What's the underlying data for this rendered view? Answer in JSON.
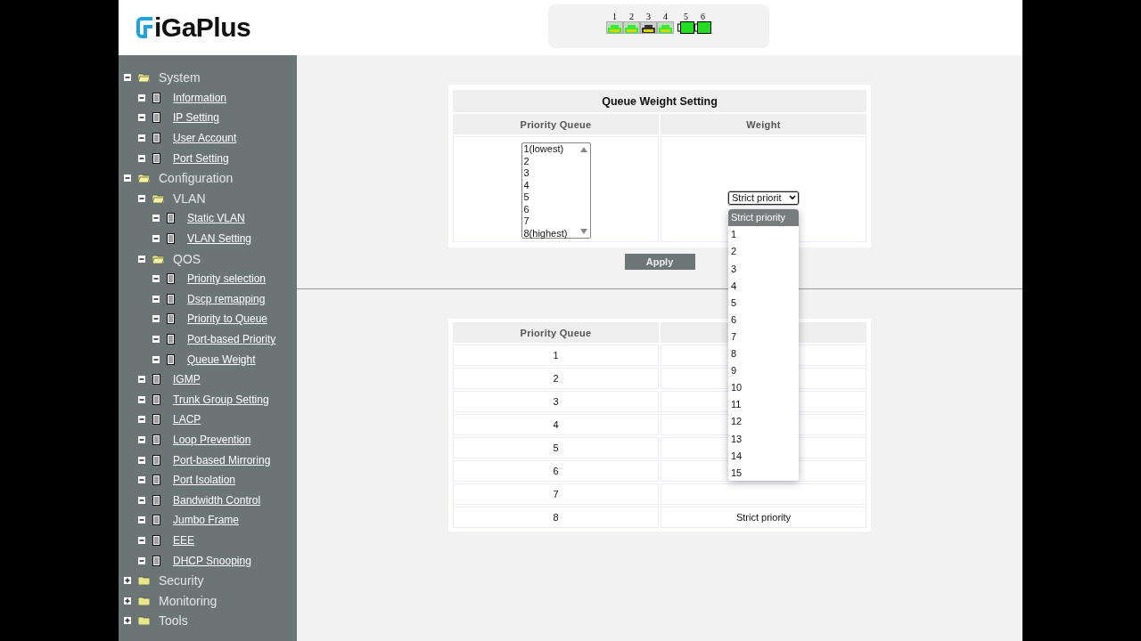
{
  "logo": {
    "prefix": "i",
    "text": "GaPlus"
  },
  "ports": [
    {
      "label": "1",
      "kind": "rj45",
      "link": true
    },
    {
      "label": "2",
      "kind": "rj45",
      "link": true
    },
    {
      "label": "3",
      "kind": "rj45",
      "link": false
    },
    {
      "label": "4",
      "kind": "rj45",
      "link": true
    },
    {
      "label": "5",
      "kind": "sfp",
      "link": true
    },
    {
      "label": "6",
      "kind": "sfp",
      "link": true
    }
  ],
  "sidebar": {
    "items": [
      {
        "label": "System",
        "kind": "folder",
        "expanded": true,
        "children": [
          {
            "label": "Information",
            "kind": "page"
          },
          {
            "label": "IP Setting",
            "kind": "page"
          },
          {
            "label": "User Account",
            "kind": "page"
          },
          {
            "label": "Port Setting",
            "kind": "page"
          }
        ]
      },
      {
        "label": "Configuration",
        "kind": "folder",
        "expanded": true,
        "children": [
          {
            "label": "VLAN",
            "kind": "folder",
            "expanded": true,
            "children": [
              {
                "label": "Static VLAN",
                "kind": "page"
              },
              {
                "label": "VLAN Setting",
                "kind": "page"
              }
            ]
          },
          {
            "label": "QOS",
            "kind": "folder",
            "expanded": true,
            "children": [
              {
                "label": "Priority selection",
                "kind": "page"
              },
              {
                "label": "Dscp remapping",
                "kind": "page"
              },
              {
                "label": "Priority to Queue",
                "kind": "page"
              },
              {
                "label": "Port-based Priority",
                "kind": "page"
              },
              {
                "label": "Queue Weight",
                "kind": "page"
              }
            ]
          },
          {
            "label": "IGMP",
            "kind": "page"
          },
          {
            "label": "Trunk Group Setting",
            "kind": "page"
          },
          {
            "label": "LACP",
            "kind": "page"
          },
          {
            "label": "Loop Prevention",
            "kind": "page"
          },
          {
            "label": "Port-based Mirroring",
            "kind": "page"
          },
          {
            "label": "Port Isolation",
            "kind": "page"
          },
          {
            "label": "Bandwidth Control",
            "kind": "page"
          },
          {
            "label": "Jumbo Frame",
            "kind": "page"
          },
          {
            "label": "EEE",
            "kind": "page"
          },
          {
            "label": "DHCP Snooping",
            "kind": "page"
          }
        ]
      },
      {
        "label": "Security",
        "kind": "folder",
        "expanded": false
      },
      {
        "label": "Monitoring",
        "kind": "folder",
        "expanded": false
      },
      {
        "label": "Tools",
        "kind": "folder",
        "expanded": false
      }
    ]
  },
  "setting": {
    "title": "Queue Weight Setting",
    "columns": [
      "Priority Queue",
      "Weight"
    ],
    "queues": [
      "1(lowest)",
      "2",
      "3",
      "4",
      "5",
      "6",
      "7",
      "8(highest)"
    ],
    "weight_select": {
      "value": "Strict priorit",
      "expanded": true,
      "options": [
        {
          "label": "Strict priority",
          "selected": true
        },
        {
          "label": "1",
          "selected": false
        },
        {
          "label": "2",
          "selected": false
        },
        {
          "label": "3",
          "selected": false
        },
        {
          "label": "4",
          "selected": false
        },
        {
          "label": "5",
          "selected": false
        },
        {
          "label": "6",
          "selected": false
        },
        {
          "label": "7",
          "selected": false
        },
        {
          "label": "8",
          "selected": false
        },
        {
          "label": "9",
          "selected": false
        },
        {
          "label": "10",
          "selected": false
        },
        {
          "label": "11",
          "selected": false
        },
        {
          "label": "12",
          "selected": false
        },
        {
          "label": "13",
          "selected": false
        },
        {
          "label": "14",
          "selected": false
        },
        {
          "label": "15",
          "selected": false
        }
      ]
    },
    "apply_button": "Apply"
  },
  "summary": {
    "columns": [
      "Priority Queue"
    ],
    "rows": [
      {
        "queue": "1"
      },
      {
        "queue": "2"
      },
      {
        "queue": "3"
      },
      {
        "queue": "4"
      },
      {
        "queue": "5"
      },
      {
        "queue": "6"
      },
      {
        "queue": "7"
      },
      {
        "queue": "8",
        "weight": "Strict priority"
      }
    ]
  }
}
